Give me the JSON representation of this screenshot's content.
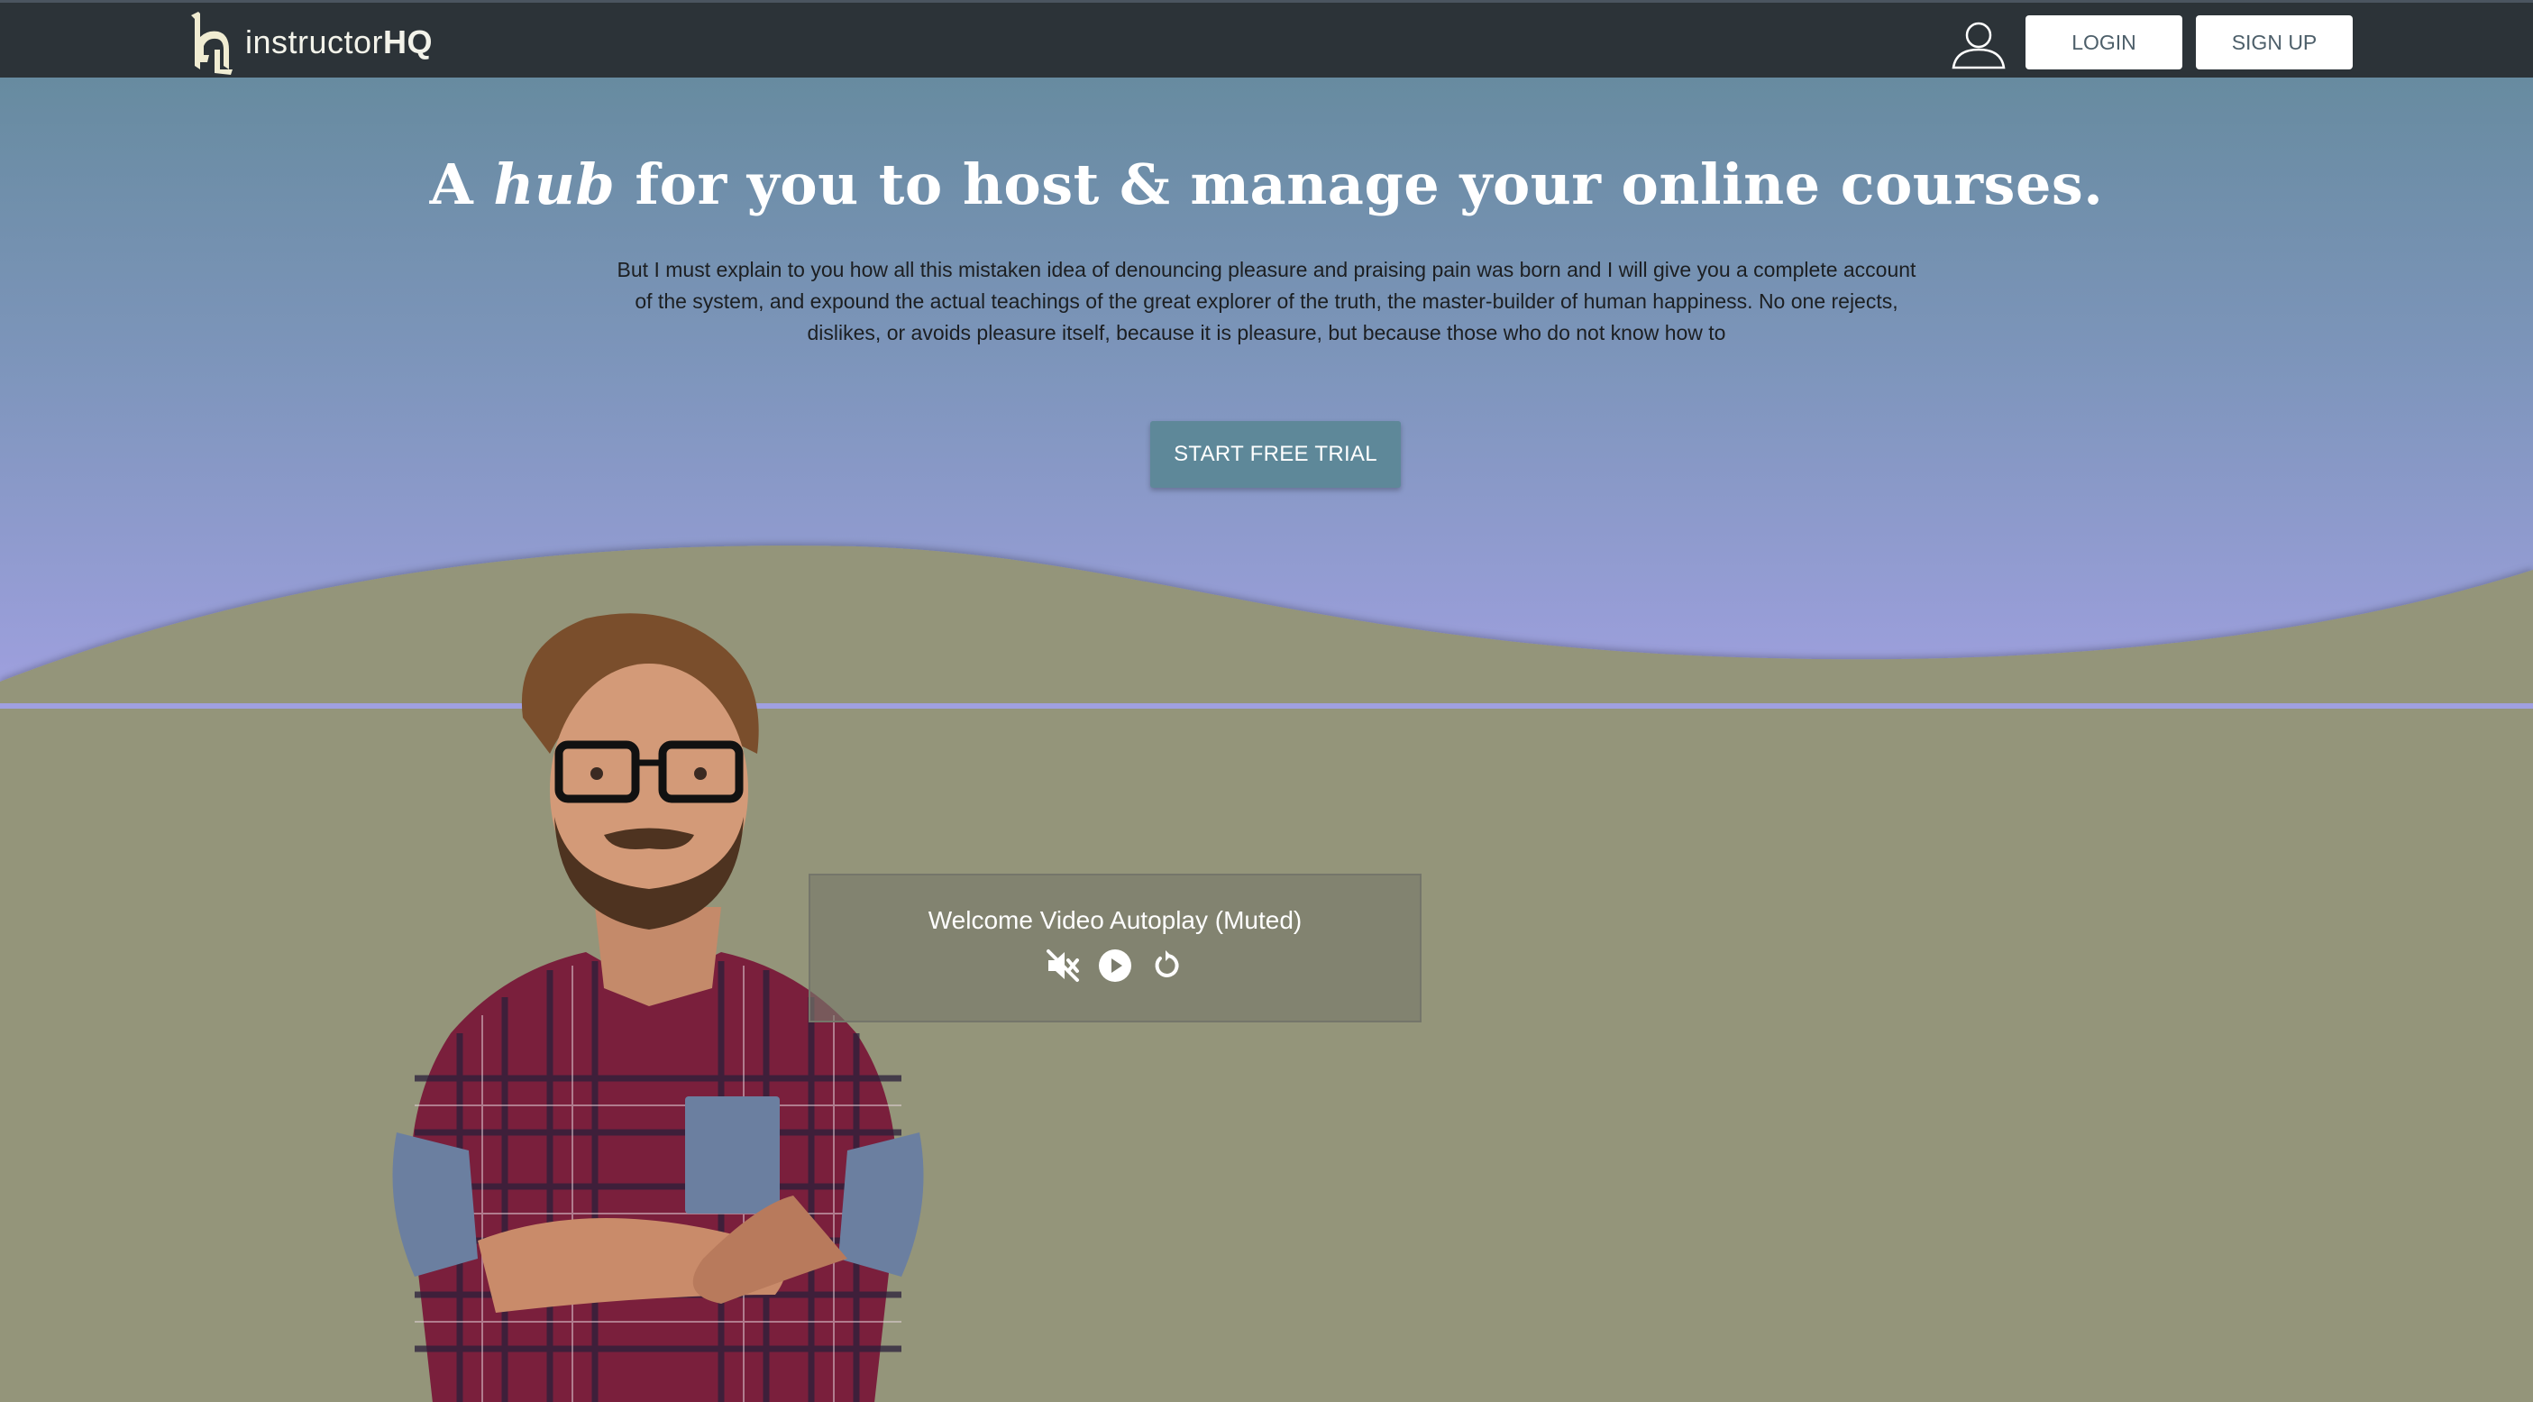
{
  "navbar": {
    "logo_text_regular": "instructor",
    "logo_text_bold": "HQ",
    "login_label": "LOGIN",
    "signup_label": "SIGN UP",
    "icons": [
      "logo-mark-icon",
      "user-account-icon"
    ]
  },
  "hero": {
    "headline_prefix": "A",
    "headline_emphasis": "hub",
    "headline_suffix": "for you to host & manage your online courses.",
    "subtext": "But I must explain to you how all this mistaken idea of denouncing pleasure and praising pain was born and I will give you a complete account of the system, and expound the actual teachings of the great explorer of the truth, the master-builder of human happiness. No one rejects, dislikes, or avoids pleasure itself, because it is pleasure, but because those who do not know how to",
    "cta_label": "START FREE TRIAL"
  },
  "video": {
    "title": "Welcome Video Autoplay (Muted)",
    "icons": [
      "muted-icon",
      "play-icon",
      "replay-icon"
    ]
  },
  "colors": {
    "navbar_bg": "#2c3338",
    "hero_top": "#678ba0",
    "hero_bottom": "#a0a0e0",
    "lower_bg": "#94957a",
    "cta_bg": "#5e8899"
  }
}
